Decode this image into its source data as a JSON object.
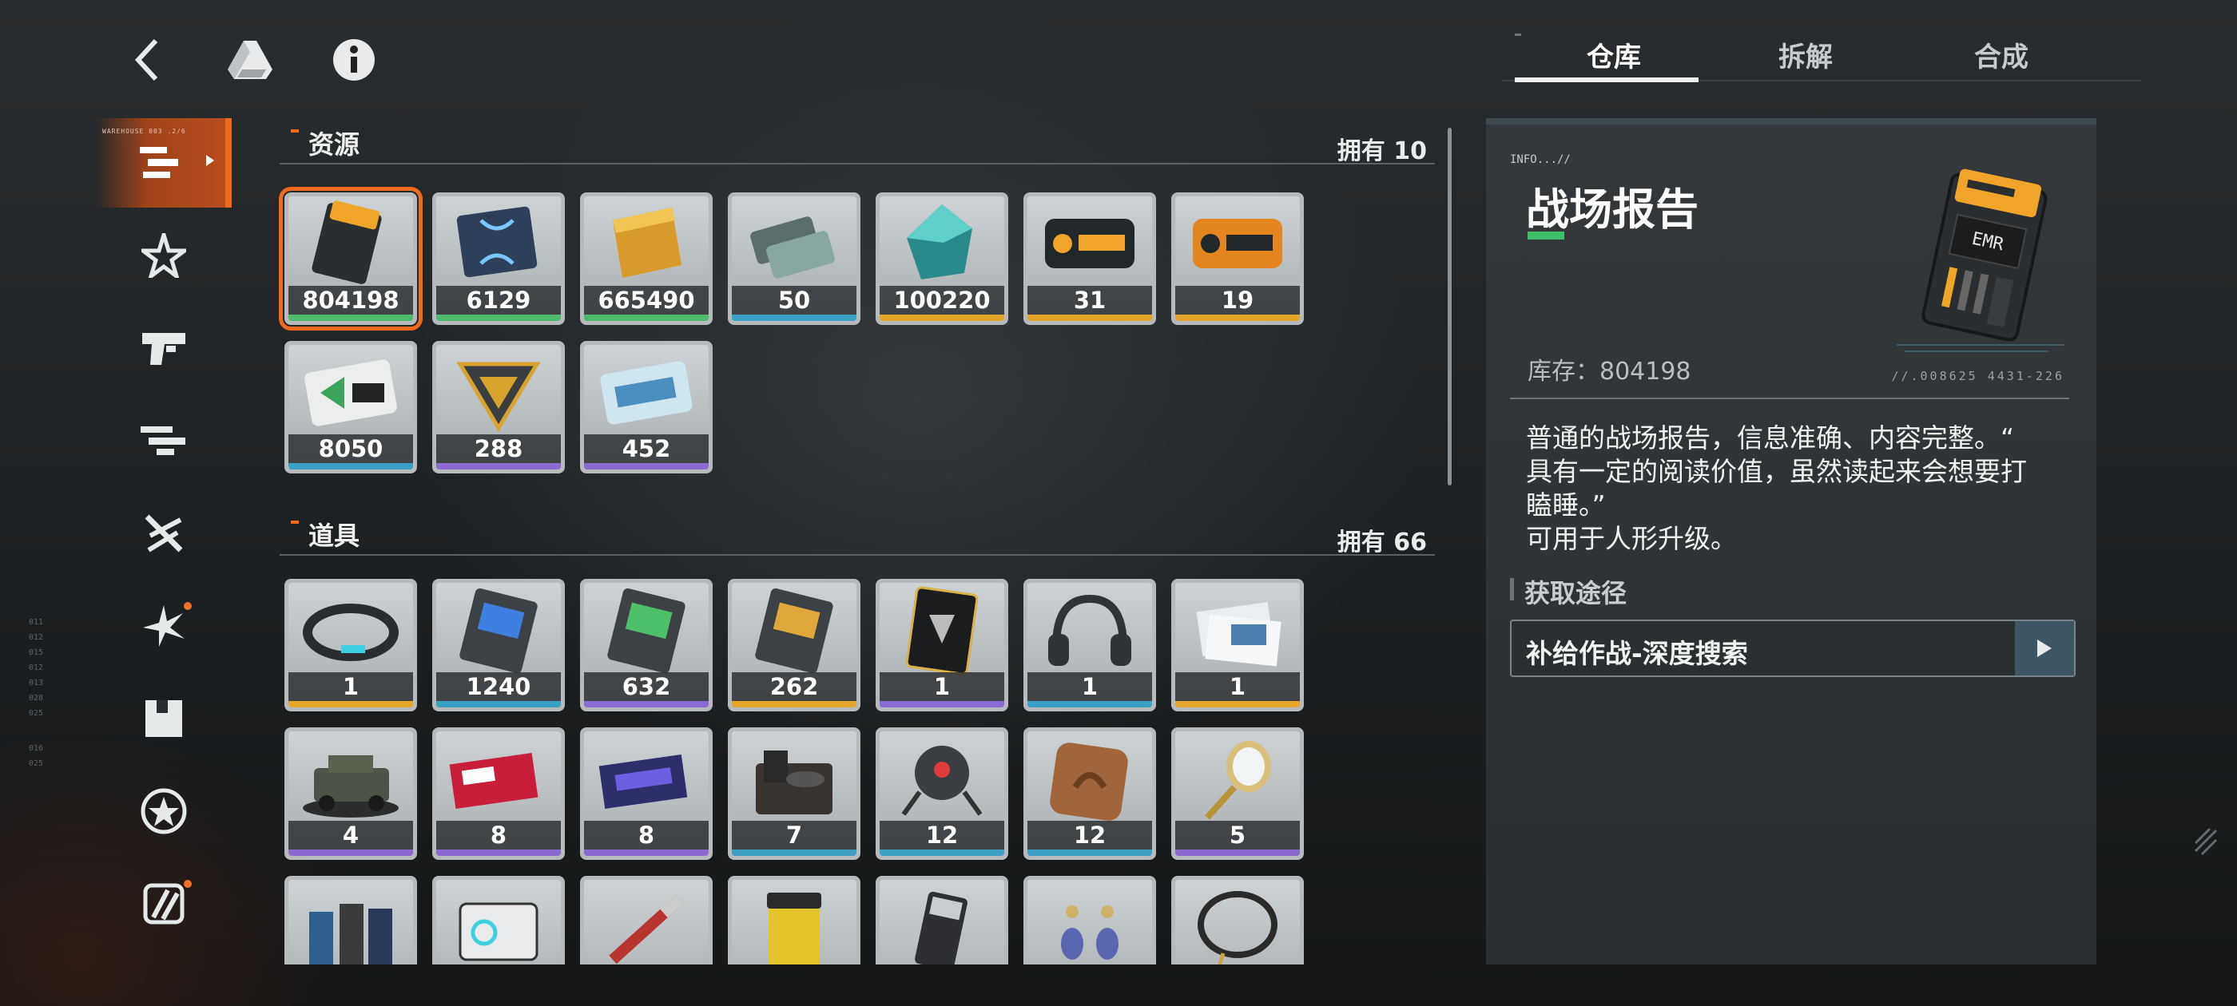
{
  "nav": {
    "back_icon": "chevron-left-icon",
    "drive_icon": "triangle-logo-icon",
    "info_icon": "info-icon"
  },
  "sidebar": {
    "active_caption": "WAREHOUSE 003 .2/6",
    "items": [
      {
        "icon": "stack-bars-icon",
        "active": true,
        "badge": false
      },
      {
        "icon": "star-burst-icon",
        "active": false,
        "badge": false
      },
      {
        "icon": "gun-icon",
        "active": false,
        "badge": false
      },
      {
        "icon": "rifle-icon",
        "active": false,
        "badge": false
      },
      {
        "icon": "crossed-blades-icon",
        "active": false,
        "badge": false
      },
      {
        "icon": "spark-icon",
        "active": false,
        "badge": true
      },
      {
        "icon": "box-icon",
        "active": false,
        "badge": false
      },
      {
        "icon": "star-circle-icon",
        "active": false,
        "badge": false
      },
      {
        "icon": "slash-square-icon",
        "active": false,
        "badge": true
      }
    ]
  },
  "sections": {
    "resources": {
      "title": "资源",
      "count": "拥有 10",
      "items": [
        {
          "qty": "804198",
          "rarity": "#4fb96d",
          "icon": "battle-report-card-icon",
          "selected": true
        },
        {
          "qty": "6129",
          "rarity": "#4fb96d",
          "icon": "dna-card-icon",
          "selected": false
        },
        {
          "qty": "665490",
          "rarity": "#4fb96d",
          "icon": "gold-bar-icon",
          "selected": false
        },
        {
          "qty": "50",
          "rarity": "#3c9fc4",
          "icon": "ticket-pair-icon",
          "selected": false
        },
        {
          "qty": "100220",
          "rarity": "#e3a62a",
          "icon": "crystal-icon",
          "selected": false
        },
        {
          "qty": "31",
          "rarity": "#e3a62a",
          "icon": "orange-chip-icon",
          "selected": false
        },
        {
          "qty": "19",
          "rarity": "#e3a62a",
          "icon": "orange-chip-large-icon",
          "selected": false
        },
        {
          "qty": "8050",
          "rarity": "#3c9fc4",
          "icon": "green-card-icon",
          "selected": false
        },
        {
          "qty": "288",
          "rarity": "#8a6ad0",
          "icon": "gold-triangle-icon",
          "selected": false
        },
        {
          "qty": "452",
          "rarity": "#8a6ad0",
          "icon": "blue-card-icon",
          "selected": false
        }
      ]
    },
    "props": {
      "title": "道具",
      "count": "拥有 66",
      "items": [
        {
          "qty": "1",
          "rarity": "#e3a62a",
          "icon": "bracelet-icon"
        },
        {
          "qty": "1240",
          "rarity": "#3c9fc4",
          "icon": "blue-chip-card-icon"
        },
        {
          "qty": "632",
          "rarity": "#8a6ad0",
          "icon": "green-chip-card-icon"
        },
        {
          "qty": "262",
          "rarity": "#e3a62a",
          "icon": "gold-chip-card-icon"
        },
        {
          "qty": "1",
          "rarity": "#8a6ad0",
          "icon": "black-card-icon"
        },
        {
          "qty": "1",
          "rarity": "#3c9fc4",
          "icon": "headphones-icon"
        },
        {
          "qty": "1",
          "rarity": "#e3a62a",
          "icon": "tickets-icon"
        },
        {
          "qty": "4",
          "rarity": "#8a6ad0",
          "icon": "jeep-icon"
        },
        {
          "qty": "8",
          "rarity": "#8a6ad0",
          "icon": "red-ticket-icon"
        },
        {
          "qty": "8",
          "rarity": "#8a6ad0",
          "icon": "concert-ticket-icon"
        },
        {
          "qty": "7",
          "rarity": "#3c9fc4",
          "icon": "toolbox-icon"
        },
        {
          "qty": "12",
          "rarity": "#3c9fc4",
          "icon": "robot-spider-icon"
        },
        {
          "qty": "12",
          "rarity": "#3c9fc4",
          "icon": "cookie-icon"
        },
        {
          "qty": "5",
          "rarity": "#8a6ad0",
          "icon": "hand-mirror-icon"
        },
        {
          "qty": "",
          "rarity": "#3c9fc4",
          "icon": "bottles-icon"
        },
        {
          "qty": "",
          "rarity": "#3c9fc4",
          "icon": "device-icon"
        },
        {
          "qty": "",
          "rarity": "#3c9fc4",
          "icon": "pen-icon"
        },
        {
          "qty": "",
          "rarity": "#3c9fc4",
          "icon": "jar-icon"
        },
        {
          "qty": "",
          "rarity": "#3c9fc4",
          "icon": "lighter-icon"
        },
        {
          "qty": "",
          "rarity": "#3c9fc4",
          "icon": "earrings-icon"
        },
        {
          "qty": "",
          "rarity": "#3c9fc4",
          "icon": "necklace-icon"
        }
      ]
    }
  },
  "tabs": [
    {
      "label": "仓库",
      "active": true
    },
    {
      "label": "拆解",
      "active": false
    },
    {
      "label": "合成",
      "active": false
    }
  ],
  "detail": {
    "info_tag": "INFO...//",
    "name": "战场报告",
    "stock": "库存：804198",
    "serial": "//.008625   4431-226",
    "description": "普通的战场报告，信息准确、内容完整。“\n具有一定的阅读价值，虽然读起来会想要打\n瞌睡。”\n可用于人形升级。",
    "source_title": "获取途径",
    "source_button": "补给作战-深度搜索",
    "source_go_icon": "play-arrow-icon",
    "art_icon": "battle-report-card-icon"
  },
  "colors": {
    "accent": "#f06a1e",
    "name_bar": "#3fbf6a",
    "panel": "#313537"
  }
}
